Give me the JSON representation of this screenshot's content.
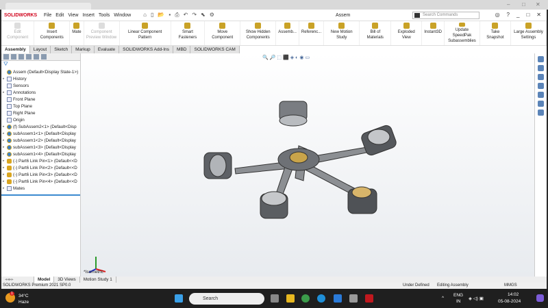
{
  "window": {
    "title": "Assem",
    "search_placeholder": "Search Commands"
  },
  "app": {
    "logo": "SOLIDWORKS"
  },
  "menu": [
    "File",
    "Edit",
    "View",
    "Insert",
    "Tools",
    "Window"
  ],
  "ribbon": [
    {
      "label": "Edit Component",
      "disabled": true
    },
    {
      "label": "Insert Components"
    },
    {
      "label": "Mate"
    },
    {
      "label": "Component Preview Window",
      "disabled": true
    },
    {
      "label": "Linear Component Pattern"
    },
    {
      "label": "Smart Fasteners"
    },
    {
      "label": "Move Component"
    },
    {
      "label": "Show Hidden Components"
    },
    {
      "label": "Assemb..."
    },
    {
      "label": "Referenc..."
    },
    {
      "label": "New Motion Study"
    },
    {
      "label": "Bill of Materials"
    },
    {
      "label": "Exploded View"
    },
    {
      "label": "Instant3D"
    },
    {
      "label": "Update SpeedPak Subassemblies"
    },
    {
      "label": "Take Snapshot"
    },
    {
      "label": "Large Assembly Settings"
    }
  ],
  "tabs": [
    "Assembly",
    "Layout",
    "Sketch",
    "Markup",
    "Evaluate",
    "SOLIDWORKS Add-Ins",
    "MBD",
    "SOLIDWORKS CAM"
  ],
  "tree": [
    {
      "label": "Assem  (Default<Display State-1>)",
      "icon": "assembly",
      "arrow": false
    },
    {
      "label": "History",
      "icon": "history",
      "arrow": true
    },
    {
      "label": "Sensors",
      "icon": "sensors",
      "arrow": false
    },
    {
      "label": "Annotations",
      "icon": "annotations",
      "arrow": true
    },
    {
      "label": "Front Plane",
      "icon": "plane",
      "arrow": false
    },
    {
      "label": "Top Plane",
      "icon": "plane",
      "arrow": false
    },
    {
      "label": "Right Plane",
      "icon": "plane",
      "arrow": false
    },
    {
      "label": "Origin",
      "icon": "origin",
      "arrow": false
    },
    {
      "label": "(f) SubAssem2<1> (Default<Disp",
      "icon": "assembly",
      "arrow": true
    },
    {
      "label": "subAssem1<1> (Default<Display",
      "icon": "assembly",
      "arrow": true
    },
    {
      "label": "subAssem1<2> (Default<Display",
      "icon": "assembly",
      "arrow": true
    },
    {
      "label": "subAssem1<3> (Default<Display",
      "icon": "assembly",
      "arrow": true
    },
    {
      "label": "subAssem1<4> (Default<Display",
      "icon": "assembly",
      "arrow": true
    },
    {
      "label": "(-) Part6 Link Pin<1> (Default<<D",
      "icon": "part",
      "arrow": true
    },
    {
      "label": "(-) Part6 Link Pin<2> (Default<<D",
      "icon": "part",
      "arrow": true
    },
    {
      "label": "(-) Part6 Link Pin<3> (Default<<D",
      "icon": "part",
      "arrow": true
    },
    {
      "label": "(-) Part6 Link Pin<4> (Default<<D",
      "icon": "part",
      "arrow": true
    },
    {
      "label": "Mates",
      "icon": "mates",
      "arrow": true
    }
  ],
  "viewport": {
    "view_label": "*Isometric"
  },
  "bottom_tabs": [
    "Model",
    "3D Views",
    "Motion Study 1"
  ],
  "status": {
    "version": "SOLIDWORKS Premium 2021 SP0.0",
    "defined": "Under Defined",
    "mode": "Editing Assembly",
    "units": "MMGS"
  },
  "taskbar": {
    "temp": "34°C",
    "weather": "Haze",
    "search": "Search",
    "lang1": "ENG",
    "lang2": "IN",
    "time": "14:02",
    "date": "05-08-2024",
    "badge": "1"
  }
}
